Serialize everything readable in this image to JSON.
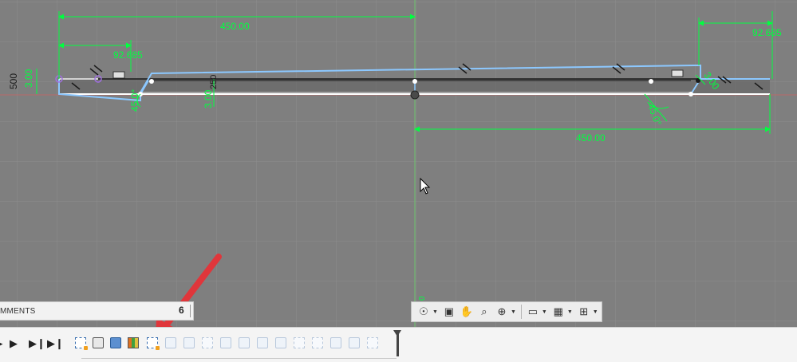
{
  "dimensions": {
    "top_left_length": "450.00",
    "left_offset": "92.685",
    "right_offset": "92.685",
    "bottom_right_length": "450.00",
    "left_thickness": "3.00",
    "center_thickness": "3.00",
    "side_value": "500",
    "center_partial": "250",
    "left_angle": "45.0°",
    "right_angle": "45.0°",
    "right_small": "3.00",
    "axis_label": "0"
  },
  "comments_panel": {
    "label": "MMENTS",
    "toggle_glyph": "6"
  },
  "navigation_toolbar": {
    "items": [
      "orbit-icon",
      "look-at-icon",
      "pan-icon",
      "zoom-icon",
      "fit-icon",
      "display-settings-icon",
      "grid-settings-icon",
      "viewports-icon"
    ]
  },
  "timeline": {
    "playback": [
      "step-back",
      "play",
      "step-forward",
      "go-to-end"
    ],
    "features": [
      "sketch",
      "box",
      "shell",
      "split",
      "sketch-active",
      "dim",
      "dim",
      "dim",
      "dim",
      "dim",
      "dim",
      "dim",
      "dim",
      "dim",
      "dim",
      "dim",
      "dim"
    ]
  },
  "colors": {
    "viewport_bg": "#7f7f7f",
    "dimension_green": "#00ff40",
    "profile_blue": "#8cc8ff",
    "arrow_red": "#e0363b"
  }
}
